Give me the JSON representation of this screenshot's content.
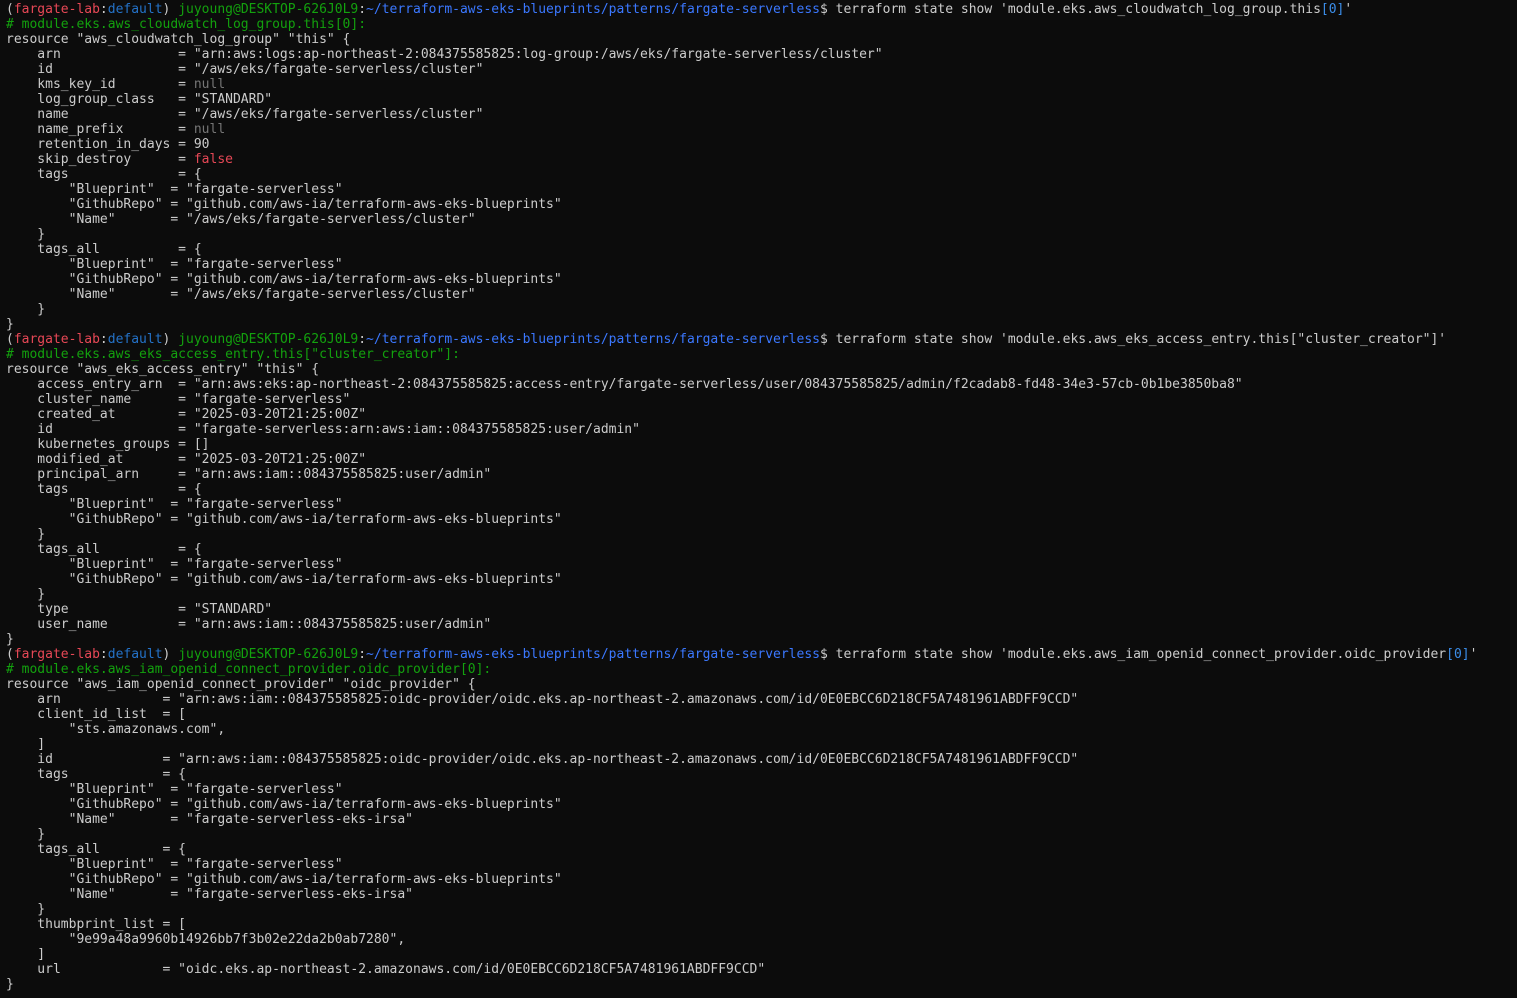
{
  "window": {
    "type": "terminal",
    "theme": {
      "background": "#0c0c0c",
      "foreground": "#cccccc",
      "env": "#e74856",
      "profile": "#2472c8",
      "user": "#13a10e",
      "path": "#3b78ff",
      "comment": "#13a10e",
      "null": "#767676",
      "false": "#e74856"
    }
  },
  "lines": [
    [
      {
        "t": "(",
        "c": "default"
      },
      {
        "t": "fargate-lab",
        "c": "env"
      },
      {
        "t": ":",
        "c": "default"
      },
      {
        "t": "default",
        "c": "prof"
      },
      {
        "t": ") ",
        "c": "default"
      },
      {
        "t": "juyoung@DESKTOP-626J0L9",
        "c": "user"
      },
      {
        "t": ":",
        "c": "default"
      },
      {
        "t": "~/terraform-aws-eks-blueprints/patterns/fargate-serverless",
        "c": "path"
      },
      {
        "t": "$ terraform state show 'module.eks.aws_cloudwatch_log_group.this",
        "c": "default"
      },
      {
        "t": "[0]",
        "c": "idx"
      },
      {
        "t": "'",
        "c": "default"
      }
    ],
    [
      {
        "t": "# module.eks.aws_cloudwatch_log_group.this[0]:",
        "c": "green"
      }
    ],
    [
      {
        "t": "resource \"aws_cloudwatch_log_group\" \"this\" {",
        "c": "default"
      }
    ],
    [
      {
        "t": "    arn               = \"arn:aws:logs:ap-northeast-2:084375585825:log-group:/aws/eks/fargate-serverless/cluster\"",
        "c": "default"
      }
    ],
    [
      {
        "t": "    id                = \"/aws/eks/fargate-serverless/cluster\"",
        "c": "default"
      }
    ],
    [
      {
        "t": "    kms_key_id        = ",
        "c": "default"
      },
      {
        "t": "null",
        "c": "null"
      }
    ],
    [
      {
        "t": "    log_group_class   = \"STANDARD\"",
        "c": "default"
      }
    ],
    [
      {
        "t": "    name              = \"/aws/eks/fargate-serverless/cluster\"",
        "c": "default"
      }
    ],
    [
      {
        "t": "    name_prefix       = ",
        "c": "default"
      },
      {
        "t": "null",
        "c": "null"
      }
    ],
    [
      {
        "t": "    retention_in_days = 90",
        "c": "default"
      }
    ],
    [
      {
        "t": "    skip_destroy      = ",
        "c": "default"
      },
      {
        "t": "false",
        "c": "false"
      }
    ],
    [
      {
        "t": "    tags              = {",
        "c": "default"
      }
    ],
    [
      {
        "t": "        \"Blueprint\"  = \"fargate-serverless\"",
        "c": "default"
      }
    ],
    [
      {
        "t": "        \"GithubRepo\" = \"github.com/aws-ia/terraform-aws-eks-blueprints\"",
        "c": "default"
      }
    ],
    [
      {
        "t": "        \"Name\"       = \"/aws/eks/fargate-serverless/cluster\"",
        "c": "default"
      }
    ],
    [
      {
        "t": "    }",
        "c": "default"
      }
    ],
    [
      {
        "t": "    tags_all          = {",
        "c": "default"
      }
    ],
    [
      {
        "t": "        \"Blueprint\"  = \"fargate-serverless\"",
        "c": "default"
      }
    ],
    [
      {
        "t": "        \"GithubRepo\" = \"github.com/aws-ia/terraform-aws-eks-blueprints\"",
        "c": "default"
      }
    ],
    [
      {
        "t": "        \"Name\"       = \"/aws/eks/fargate-serverless/cluster\"",
        "c": "default"
      }
    ],
    [
      {
        "t": "    }",
        "c": "default"
      }
    ],
    [
      {
        "t": "}",
        "c": "default"
      }
    ],
    [
      {
        "t": "(",
        "c": "default"
      },
      {
        "t": "fargate-lab",
        "c": "env"
      },
      {
        "t": ":",
        "c": "default"
      },
      {
        "t": "default",
        "c": "prof"
      },
      {
        "t": ") ",
        "c": "default"
      },
      {
        "t": "juyoung@DESKTOP-626J0L9",
        "c": "user"
      },
      {
        "t": ":",
        "c": "default"
      },
      {
        "t": "~/terraform-aws-eks-blueprints/patterns/fargate-serverless",
        "c": "path"
      },
      {
        "t": "$ terraform state show 'module.eks.aws_eks_access_entry.this[\"cluster_creator\"]'",
        "c": "default"
      }
    ],
    [
      {
        "t": "# module.eks.aws_eks_access_entry.this[\"cluster_creator\"]:",
        "c": "green"
      }
    ],
    [
      {
        "t": "resource \"aws_eks_access_entry\" \"this\" {",
        "c": "default"
      }
    ],
    [
      {
        "t": "    access_entry_arn  = \"arn:aws:eks:ap-northeast-2:084375585825:access-entry/fargate-serverless/user/084375585825/admin/f2cadab8-fd48-34e3-57cb-0b1be3850ba8\"",
        "c": "default"
      }
    ],
    [
      {
        "t": "    cluster_name      = \"fargate-serverless\"",
        "c": "default"
      }
    ],
    [
      {
        "t": "    created_at        = \"2025-03-20T21:25:00Z\"",
        "c": "default"
      }
    ],
    [
      {
        "t": "    id                = \"fargate-serverless:arn:aws:iam::084375585825:user/admin\"",
        "c": "default"
      }
    ],
    [
      {
        "t": "    kubernetes_groups = []",
        "c": "default"
      }
    ],
    [
      {
        "t": "    modified_at       = \"2025-03-20T21:25:00Z\"",
        "c": "default"
      }
    ],
    [
      {
        "t": "    principal_arn     = \"arn:aws:iam::084375585825:user/admin\"",
        "c": "default"
      }
    ],
    [
      {
        "t": "    tags              = {",
        "c": "default"
      }
    ],
    [
      {
        "t": "        \"Blueprint\"  = \"fargate-serverless\"",
        "c": "default"
      }
    ],
    [
      {
        "t": "        \"GithubRepo\" = \"github.com/aws-ia/terraform-aws-eks-blueprints\"",
        "c": "default"
      }
    ],
    [
      {
        "t": "    }",
        "c": "default"
      }
    ],
    [
      {
        "t": "    tags_all          = {",
        "c": "default"
      }
    ],
    [
      {
        "t": "        \"Blueprint\"  = \"fargate-serverless\"",
        "c": "default"
      }
    ],
    [
      {
        "t": "        \"GithubRepo\" = \"github.com/aws-ia/terraform-aws-eks-blueprints\"",
        "c": "default"
      }
    ],
    [
      {
        "t": "    }",
        "c": "default"
      }
    ],
    [
      {
        "t": "    type              = \"STANDARD\"",
        "c": "default"
      }
    ],
    [
      {
        "t": "    user_name         = \"arn:aws:iam::084375585825:user/admin\"",
        "c": "default"
      }
    ],
    [
      {
        "t": "}",
        "c": "default"
      }
    ],
    [
      {
        "t": "(",
        "c": "default"
      },
      {
        "t": "fargate-lab",
        "c": "env"
      },
      {
        "t": ":",
        "c": "default"
      },
      {
        "t": "default",
        "c": "prof"
      },
      {
        "t": ") ",
        "c": "default"
      },
      {
        "t": "juyoung@DESKTOP-626J0L9",
        "c": "user"
      },
      {
        "t": ":",
        "c": "default"
      },
      {
        "t": "~/terraform-aws-eks-blueprints/patterns/fargate-serverless",
        "c": "path"
      },
      {
        "t": "$ terraform state show 'module.eks.aws_iam_openid_connect_provider.oidc_provider",
        "c": "default"
      },
      {
        "t": "[0]",
        "c": "idx"
      },
      {
        "t": "'",
        "c": "default"
      }
    ],
    [
      {
        "t": "# module.eks.aws_iam_openid_connect_provider.oidc_provider[0]:",
        "c": "green"
      }
    ],
    [
      {
        "t": "resource \"aws_iam_openid_connect_provider\" \"oidc_provider\" {",
        "c": "default"
      }
    ],
    [
      {
        "t": "    arn             = \"arn:aws:iam::084375585825:oidc-provider/oidc.eks.ap-northeast-2.amazonaws.com/id/0E0EBCC6D218CF5A7481961ABDFF9CCD\"",
        "c": "default"
      }
    ],
    [
      {
        "t": "    client_id_list  = [",
        "c": "default"
      }
    ],
    [
      {
        "t": "        \"sts.amazonaws.com\",",
        "c": "default"
      }
    ],
    [
      {
        "t": "    ]",
        "c": "default"
      }
    ],
    [
      {
        "t": "    id              = \"arn:aws:iam::084375585825:oidc-provider/oidc.eks.ap-northeast-2.amazonaws.com/id/0E0EBCC6D218CF5A7481961ABDFF9CCD\"",
        "c": "default"
      }
    ],
    [
      {
        "t": "    tags            = {",
        "c": "default"
      }
    ],
    [
      {
        "t": "        \"Blueprint\"  = \"fargate-serverless\"",
        "c": "default"
      }
    ],
    [
      {
        "t": "        \"GithubRepo\" = \"github.com/aws-ia/terraform-aws-eks-blueprints\"",
        "c": "default"
      }
    ],
    [
      {
        "t": "        \"Name\"       = \"fargate-serverless-eks-irsa\"",
        "c": "default"
      }
    ],
    [
      {
        "t": "    }",
        "c": "default"
      }
    ],
    [
      {
        "t": "    tags_all        = {",
        "c": "default"
      }
    ],
    [
      {
        "t": "        \"Blueprint\"  = \"fargate-serverless\"",
        "c": "default"
      }
    ],
    [
      {
        "t": "        \"GithubRepo\" = \"github.com/aws-ia/terraform-aws-eks-blueprints\"",
        "c": "default"
      }
    ],
    [
      {
        "t": "        \"Name\"       = \"fargate-serverless-eks-irsa\"",
        "c": "default"
      }
    ],
    [
      {
        "t": "    }",
        "c": "default"
      }
    ],
    [
      {
        "t": "    thumbprint_list = [",
        "c": "default"
      }
    ],
    [
      {
        "t": "        \"9e99a48a9960b14926bb7f3b02e22da2b0ab7280\",",
        "c": "default"
      }
    ],
    [
      {
        "t": "    ]",
        "c": "default"
      }
    ],
    [
      {
        "t": "    url             = \"oidc.eks.ap-northeast-2.amazonaws.com/id/0E0EBCC6D218CF5A7481961ABDFF9CCD\"",
        "c": "default"
      }
    ],
    [
      {
        "t": "}",
        "c": "default"
      }
    ]
  ]
}
